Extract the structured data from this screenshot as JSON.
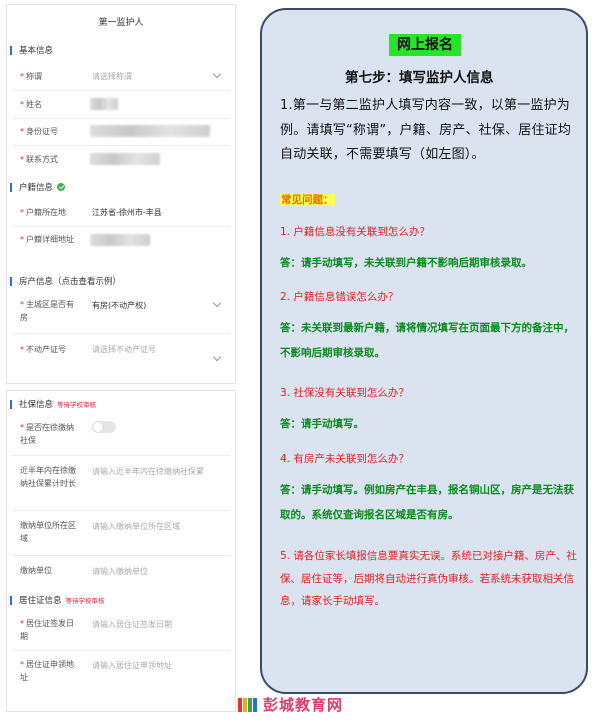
{
  "form": {
    "title": "第一监护人",
    "basic": {
      "heading": "基本信息",
      "title_label": "称谓",
      "title_placeholder": "请选择称谓",
      "name_label": "姓名",
      "id_label": "身份证号",
      "contact_label": "联系方式"
    },
    "hukou": {
      "heading": "户籍信息",
      "location_label": "户籍所在地",
      "location_value": "江苏省-徐州市-丰县",
      "address_label": "户籍详细地址"
    },
    "house": {
      "heading": "房产信息（点击查看示例）",
      "owns_label": "主城区是否有房",
      "owns_value": "有房(不动产权)",
      "cert_label": "不动产证号",
      "cert_placeholder": "请选择不动产证号"
    },
    "social": {
      "heading": "社保信息",
      "tag": "等待学校审核",
      "paying_label": "是否在徐缴纳社保",
      "months_label": "近半年内在徐缴纳社保累计时长",
      "months_placeholder": "请输入近半年内在徐缴纳社保累",
      "unit_area_label": "缴纳单位所在区域",
      "unit_area_placeholder": "请输入缴纳单位所在区域",
      "unit_label": "缴纳单位",
      "unit_placeholder": "请输入缴纳单位"
    },
    "residence": {
      "heading": "居住证信息",
      "tag": "等待学校审核",
      "date_label": "居住证签发日期",
      "date_placeholder": "请输入居住证签发日期",
      "addr_label": "居住证申领地址",
      "addr_placeholder": "请输入居住证申领地址"
    }
  },
  "card": {
    "banner": "网上报名",
    "step": "第七步：填写监护人信息",
    "intro": "1.第一与第二监护人填写内容一致，以第一监护为例。请填写“称谓”，户籍、房产、社保、居住证均自动关联，不需要填写（如左图）。",
    "faq_heading": "常见问题：",
    "q1": "1. 户籍信息没有关联到怎么办？",
    "a1": "答：请手动填写，未关联到户籍不影响后期审核录取。",
    "q2": "2. 户籍信息错误怎么办？",
    "a2": "答：未关联到最新户籍，请将情况填写在页面最下方的备注中，不影响后期审核录取。",
    "q3": "3. 社保没有关联到怎么办？",
    "a3": "答：请手动填写。",
    "q4": "4. 有房产未关联到怎么办？",
    "a4": "答：请手动填写。例如房产在丰县，报名铜山区，房产是无法获取的。系统仅查询报名区域是否有房。",
    "note": "5. 请各位家长填报信息要真实无误。系统已对接户籍、房产、社保、居住证等，后期将自动进行真伪审核。若系统未获取相关信息，请家长手动填写。"
  },
  "watermark": "彭城教育网",
  "colors": {
    "accent_blue": "#2a6fd6",
    "card_bg": "#dbe3f1",
    "banner_green": "#27e427",
    "answer_green": "#0b8a1e",
    "question_red": "#e32020"
  }
}
